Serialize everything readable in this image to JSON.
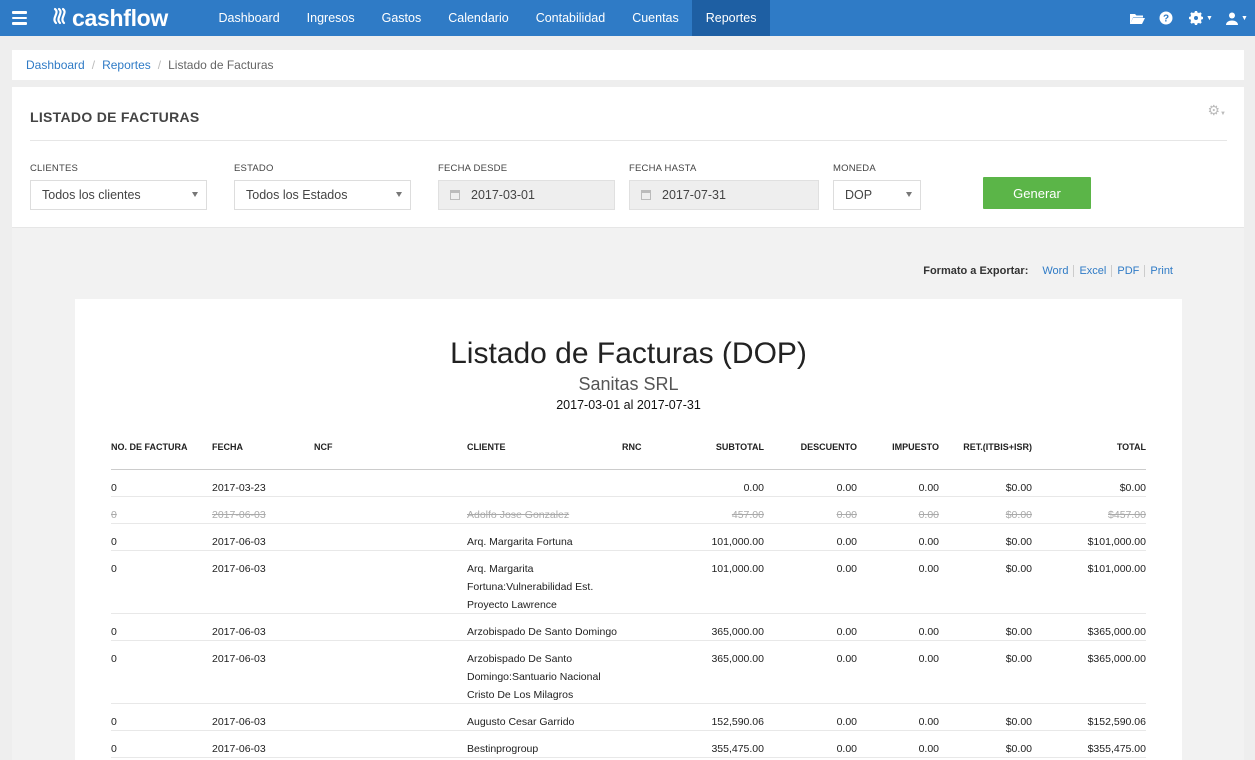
{
  "app": {
    "logo_text": "cashflow"
  },
  "nav": {
    "items": [
      "Dashboard",
      "Ingresos",
      "Gastos",
      "Calendario",
      "Contabilidad",
      "Cuentas",
      "Reportes"
    ],
    "active": "Reportes"
  },
  "breadcrumb": {
    "home": "Dashboard",
    "section": "Reportes",
    "current": "Listado de Facturas"
  },
  "page": {
    "title": "LISTADO DE FACTURAS"
  },
  "filters": {
    "clientes": {
      "label": "CLIENTES",
      "value": "Todos los clientes"
    },
    "estado": {
      "label": "ESTADO",
      "value": "Todos los Estados"
    },
    "fecha_desde": {
      "label": "FECHA DESDE",
      "value": "2017-03-01"
    },
    "fecha_hasta": {
      "label": "FECHA HASTA",
      "value": "2017-07-31"
    },
    "moneda": {
      "label": "MONEDA",
      "value": "DOP"
    },
    "generar": "Generar"
  },
  "export": {
    "label": "Formato a Exportar:",
    "word": "Word",
    "excel": "Excel",
    "pdf": "PDF",
    "print": "Print"
  },
  "report": {
    "title": "Listado de Facturas (DOP)",
    "company": "Sanitas SRL",
    "range": "2017-03-01 al 2017-07-31",
    "headers": {
      "no": "NO. DE FACTURA",
      "fecha": "FECHA",
      "ncf": "NCF",
      "cliente": "CLIENTE",
      "rnc": "RNC",
      "subtotal": "SUBTOTAL",
      "descuento": "DESCUENTO",
      "impuesto": "IMPUESTO",
      "ret": "RET.(ITBIS+ISR)",
      "total": "TOTAL"
    },
    "rows": [
      {
        "no": "0",
        "fecha": "2017-03-23",
        "cliente": "",
        "subtotal": "0.00",
        "descuento": "0.00",
        "impuesto": "0.00",
        "ret": "$0.00",
        "total": "$0.00",
        "void": false
      },
      {
        "no": "0",
        "fecha": "2017-06-03",
        "cliente": "Adolfo Jose Gonzalez",
        "subtotal": "457.00",
        "descuento": "0.00",
        "impuesto": "0.00",
        "ret": "$0.00",
        "total": "$457.00",
        "void": true
      },
      {
        "no": "0",
        "fecha": "2017-06-03",
        "cliente": "Arq. Margarita Fortuna",
        "subtotal": "101,000.00",
        "descuento": "0.00",
        "impuesto": "0.00",
        "ret": "$0.00",
        "total": "$101,000.00",
        "void": false
      },
      {
        "no": "0",
        "fecha": "2017-06-03",
        "cliente": [
          "Arq. Margarita",
          "Fortuna:Vulnerabilidad Est.",
          "Proyecto Lawrence"
        ],
        "subtotal": "101,000.00",
        "descuento": "0.00",
        "impuesto": "0.00",
        "ret": "$0.00",
        "total": "$101,000.00",
        "void": false
      },
      {
        "no": "0",
        "fecha": "2017-06-03",
        "cliente": "Arzobispado De Santo Domingo",
        "subtotal": "365,000.00",
        "descuento": "0.00",
        "impuesto": "0.00",
        "ret": "$0.00",
        "total": "$365,000.00",
        "void": false
      },
      {
        "no": "0",
        "fecha": "2017-06-03",
        "cliente": [
          "Arzobispado De Santo",
          "Domingo:Santuario Nacional",
          "Cristo De Los Milagros"
        ],
        "subtotal": "365,000.00",
        "descuento": "0.00",
        "impuesto": "0.00",
        "ret": "$0.00",
        "total": "$365,000.00",
        "void": false
      },
      {
        "no": "0",
        "fecha": "2017-06-03",
        "cliente": "Augusto Cesar Garrido",
        "subtotal": "152,590.06",
        "descuento": "0.00",
        "impuesto": "0.00",
        "ret": "$0.00",
        "total": "$152,590.06",
        "void": false
      },
      {
        "no": "0",
        "fecha": "2017-06-03",
        "cliente": "Bestinprogroup",
        "subtotal": "355,475.00",
        "descuento": "0.00",
        "impuesto": "0.00",
        "ret": "$0.00",
        "total": "$355,475.00",
        "void": false
      }
    ]
  }
}
